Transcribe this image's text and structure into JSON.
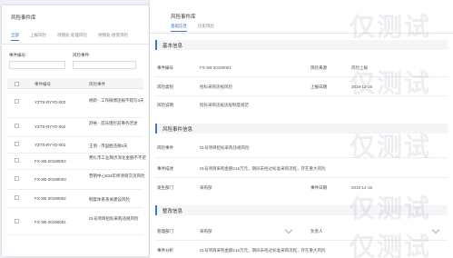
{
  "left": {
    "title": "风险事件库",
    "tabs": [
      "全部",
      "上报风险",
      "待我处-处理风险",
      "待我处-接受风险"
    ],
    "filter": {
      "code_label": "事件编号:",
      "name_label": "风险事件:"
    },
    "columns": {
      "code": "事件编号",
      "name": "风险事件"
    },
    "rows": [
      {
        "code": "YZTS-RYYD-003",
        "name": "杨新 - 工作微博违规不错写3天"
      },
      {
        "code": "YZTS-RYYD-002",
        "name": "舒裕 - 首员阻拦前事务迟述"
      },
      {
        "code": "YZTS-RYYD-001",
        "name": "王俏 - 市国胜违规5天"
      },
      {
        "code": "FX-SB-20190004",
        "name": "费扎市工业网点深化金额不不足"
      },
      {
        "code": "FX-SB-20190003",
        "name": "营销中心834年终项目交流风险"
      },
      {
        "code": "FX-SB-20190002",
        "name": "制度体系系关建设风险"
      },
      {
        "code": "FX-SB-20190001",
        "name": "01号项目招标采购违规风险"
      }
    ]
  },
  "right": {
    "title": "风险事件库",
    "tabs": [
      "基础信息",
      "历史风险"
    ],
    "sections": {
      "basic": "基本信息",
      "event": "风险事件信息",
      "rectify": "整改信息"
    },
    "basic": {
      "code_label": "事件编号",
      "code_value": "FX-SB-20190001",
      "source_label": "风险来源",
      "source_value": "风险上报",
      "type_label": "风险类别",
      "type_value": "招标采购违规风险",
      "date_label": "上报日期",
      "date_value": "2019-12-16",
      "reason_label": "风险说明",
      "reason_value": "招标采购违规违规制度规范"
    },
    "event": {
      "name_label": "风险事件",
      "name_value": "01号项目招标采购违规风险",
      "desc_label": "事件描述",
      "desc_value": "01号项目采购金额215万元，期间未经过标准采购流程，存在重大风险",
      "place_label": "发生部门",
      "place_value": "采购部",
      "date_label": "事件日期",
      "date_value": "2019-12-16"
    },
    "rectify": {
      "dept_label": "管理部门",
      "dept_value": "采购部",
      "owner_label": "负责人",
      "owner_value": "",
      "analysis_label": "事件分析",
      "analysis_value": "01号项目采购金额215万元，期间未经过标准采购流程，存在重大风险"
    }
  },
  "watermark": "仅测试"
}
